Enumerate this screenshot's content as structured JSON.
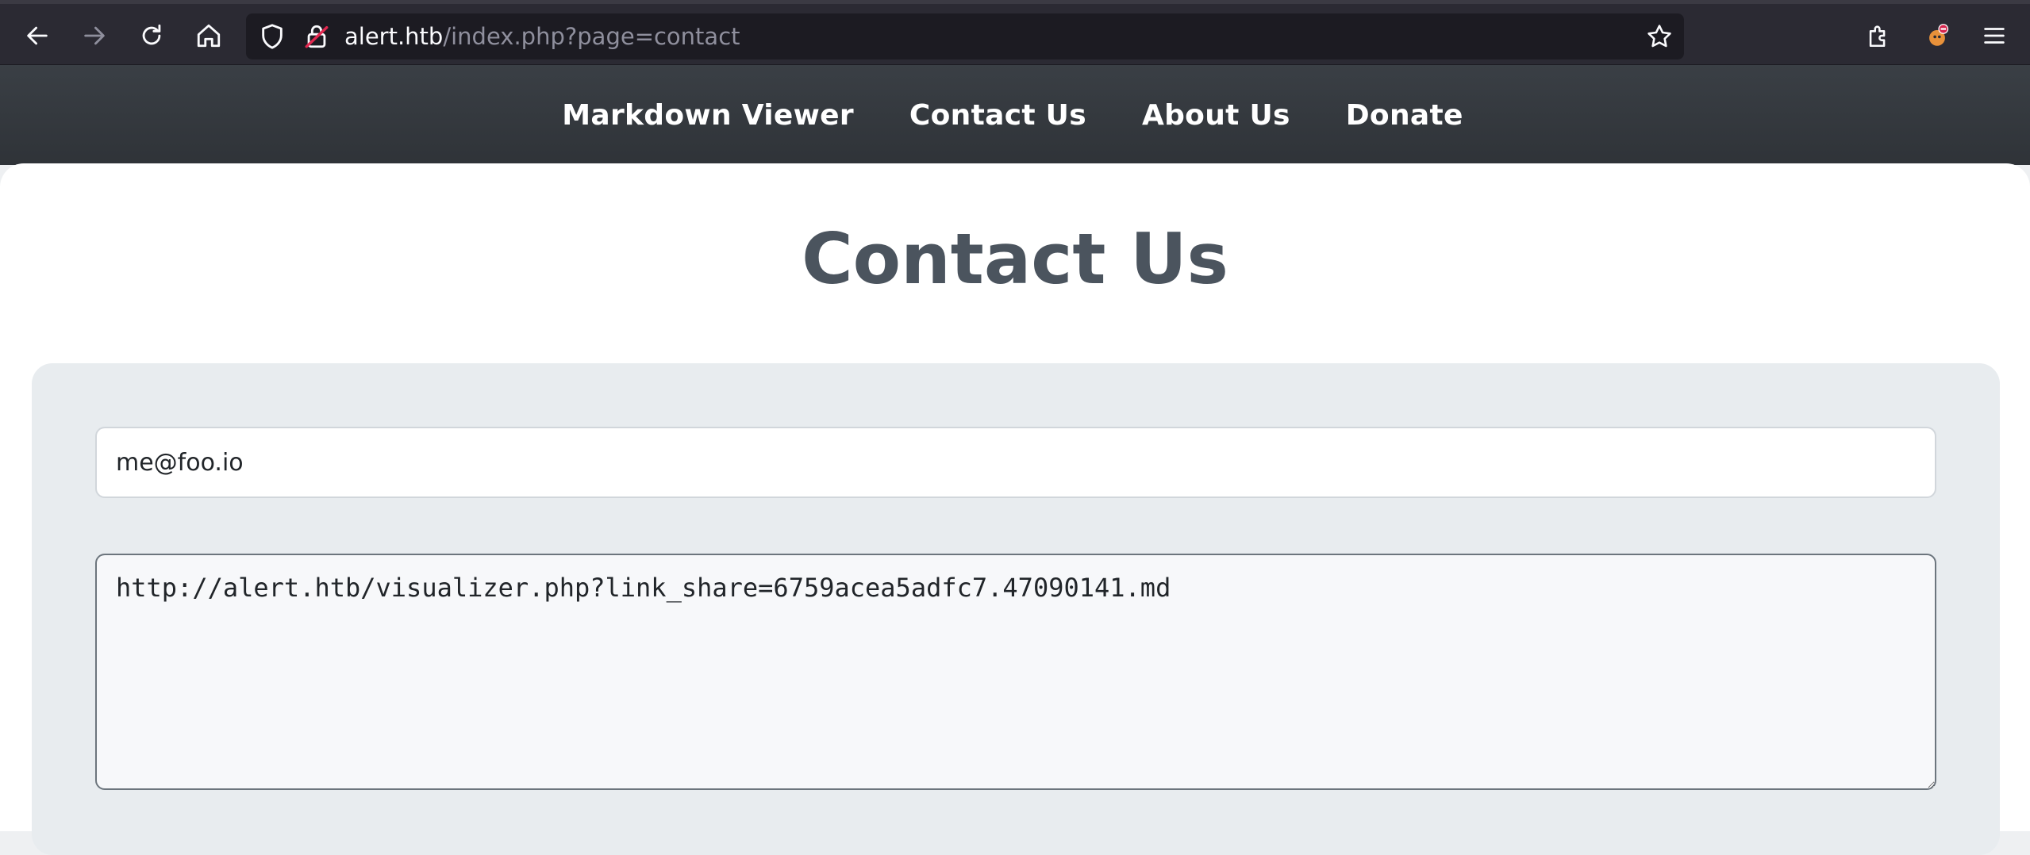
{
  "browser": {
    "url_host": "alert.htb",
    "url_path": "/index.php?page=contact",
    "icons": [
      "back-icon",
      "forward-icon",
      "reload-icon",
      "home-icon",
      "shield-icon",
      "insecure-lock-icon",
      "bookmark-star-icon",
      "extensions-icon",
      "profile-avatar-icon",
      "menu-icon"
    ]
  },
  "site_nav": {
    "items": [
      {
        "label": "Markdown Viewer"
      },
      {
        "label": "Contact Us"
      },
      {
        "label": "About Us"
      },
      {
        "label": "Donate"
      }
    ]
  },
  "page": {
    "title": "Contact Us"
  },
  "form": {
    "email_value": "me@foo.io",
    "message_value": "http://alert.htb/visualizer.php?link_share=6759acea5adfc7.47090141.md"
  },
  "colors": {
    "chrome_bg": "#2b2a33",
    "nav_bg": "#343a40",
    "title_color": "#4b545e",
    "card_bg": "#e8ecef"
  }
}
